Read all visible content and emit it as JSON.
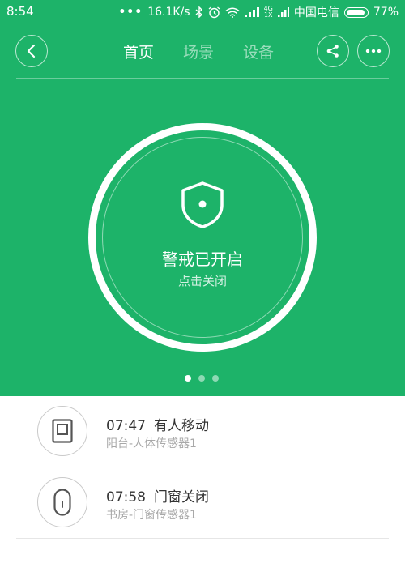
{
  "status_bar": {
    "time": "8:54",
    "speed": "16.1K/s",
    "network_small": "4G",
    "network_small2": "1X",
    "carrier": "中国电信",
    "battery": "77%",
    "icons": [
      "more-dots-icon",
      "bluetooth-icon",
      "alarm-clock-icon",
      "wifi-icon",
      "signal-icon",
      "battery-icon"
    ]
  },
  "nav": {
    "tabs": [
      {
        "label": "首页",
        "active": true
      },
      {
        "label": "场景",
        "active": false
      },
      {
        "label": "设备",
        "active": false
      }
    ],
    "icons": [
      "back-icon",
      "share-icon",
      "more-icon"
    ]
  },
  "alarm": {
    "title": "警戒已开启",
    "subtitle": "点击关闭",
    "icon": "shield-icon"
  },
  "pager": {
    "count": 3,
    "active": 0
  },
  "events": [
    {
      "time": "07:47",
      "title": "有人移动",
      "source": "阳台-人体传感器1",
      "icon": "motion-sensor-icon"
    },
    {
      "time": "07:58",
      "title": "门窗关闭",
      "source": "书房-门窗传感器1",
      "icon": "door-sensor-icon"
    }
  ],
  "colors": {
    "accent": "#1db369",
    "text": "#333333",
    "subtext": "#a8a8a8"
  }
}
